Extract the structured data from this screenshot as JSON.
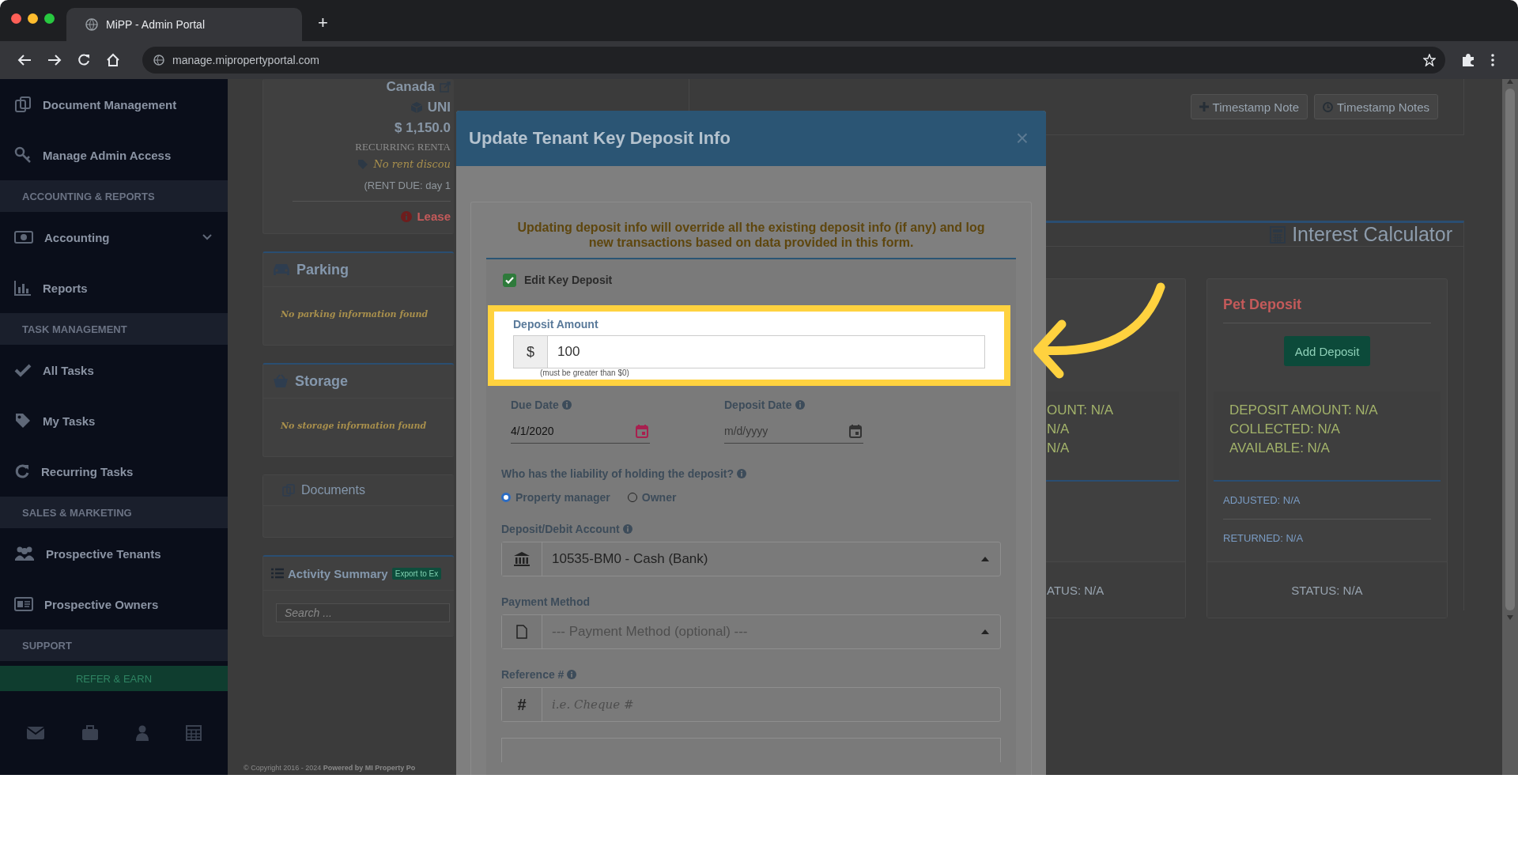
{
  "browser": {
    "tab_title": "MiPP - Admin Portal",
    "new_tab": "+",
    "url": "manage.mipropertyportal.com"
  },
  "sidebar": {
    "sections": [
      {
        "items": [
          {
            "label": "Document Management",
            "has_submenu": false
          },
          {
            "label": "Manage Admin Access",
            "has_submenu": false
          }
        ]
      },
      {
        "header": "ACCOUNTING & REPORTS",
        "items": [
          {
            "label": "Accounting",
            "has_submenu": true
          },
          {
            "label": "Reports",
            "has_submenu": false
          }
        ]
      },
      {
        "header": "TASK MANAGEMENT",
        "items": [
          {
            "label": "All Tasks",
            "has_submenu": false
          },
          {
            "label": "My Tasks",
            "has_submenu": false
          },
          {
            "label": "Recurring Tasks",
            "has_submenu": false
          }
        ]
      },
      {
        "header": "SALES & MARKETING",
        "items": [
          {
            "label": "Prospective Tenants",
            "has_submenu": false
          },
          {
            "label": "Prospective Owners",
            "has_submenu": false
          }
        ]
      },
      {
        "header": "SUPPORT"
      }
    ],
    "refer_button": "REFER & EARN"
  },
  "unit_card": {
    "address_line": "Canada",
    "unit": "UNI",
    "rent": "$ 1,150.0",
    "recurring": "RECURRING RENTA",
    "discount": "No rent discou",
    "rent_due": "(RENT DUE: day 1",
    "lease": "Lease"
  },
  "parking": {
    "title": "Parking",
    "empty": "No parking information found"
  },
  "storage": {
    "title": "Storage",
    "empty": "No storage information found"
  },
  "documents": {
    "title": "Documents"
  },
  "activity": {
    "title": "Activity Summary",
    "export": "Export to Ex",
    "search_placeholder": "Search ..."
  },
  "footer": "© Copyright 2016 - 2024 **Powered by MI Property Po**",
  "timestamp_buttons": [
    "Timestamp Note",
    "Timestamp Notes"
  ],
  "interest_calculator": "Interest Calculator",
  "partial_card": {
    "lines": [
      "OUNT: N/A",
      "N/A",
      "N/A"
    ],
    "status": "ATUS: N/A"
  },
  "pet_card": {
    "title": "Pet Deposit",
    "button": "Add Deposit",
    "lines": [
      "DEPOSIT AMOUNT: N/A",
      "COLLECTED: N/A",
      "AVAILABLE: N/A"
    ],
    "adjusted": "ADJUSTED: N/A",
    "returned": "RETURNED: N/A",
    "status": "STATUS: N/A"
  },
  "modal": {
    "title": "Update Tenant Key Deposit Info",
    "close": "×",
    "warning": "Updating deposit info will override all the existing deposit info (if any) and log new transactions based on data provided in this form.",
    "edit_checkbox": {
      "label": "Edit Key Deposit",
      "checked": true
    },
    "deposit_amount": {
      "label": "Deposit Amount",
      "prefix": "$",
      "value": "100",
      "hint": "(must be greater than $0)"
    },
    "due_date": {
      "label": "Due Date",
      "value": "4/1/2020"
    },
    "deposit_date": {
      "label": "Deposit Date",
      "placeholder": "m/d/yyyy"
    },
    "liability": {
      "question": "Who has the liability of holding the deposit?",
      "options": [
        {
          "label": "Property manager",
          "selected": true
        },
        {
          "label": "Owner",
          "selected": false
        }
      ]
    },
    "account": {
      "label": "Deposit/Debit Account",
      "value": "10535-BM0 - Cash (Bank)"
    },
    "payment_method": {
      "label": "Payment Method",
      "placeholder": "--- Payment Method (optional) ---"
    },
    "reference": {
      "label": "Reference #",
      "prefix": "#",
      "placeholder": "i.e. Cheque #"
    }
  }
}
